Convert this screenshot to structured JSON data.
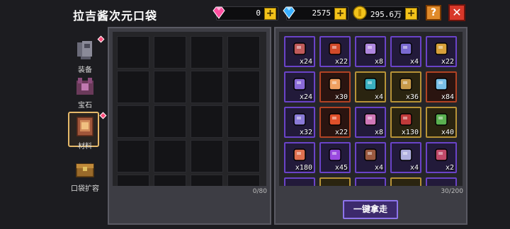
{
  "title": "拉吉酱次元口袋",
  "currencies": {
    "pink_gem": "0",
    "blue_diamond": "2575",
    "gold_coin": "295.6万"
  },
  "top_buttons": {
    "help": "?",
    "close": "✕"
  },
  "sidebar": [
    {
      "label": "装备",
      "icon": "armor-icon",
      "badge": true,
      "active": false
    },
    {
      "label": "宝石",
      "icon": "gem-chest-icon",
      "badge": false,
      "active": false
    },
    {
      "label": "材料",
      "icon": "material-book-icon",
      "badge": true,
      "active": true
    },
    {
      "label": "口袋扩容",
      "icon": "chest-expand-icon",
      "badge": false,
      "active": false
    }
  ],
  "left_panel": {
    "count": "0/80"
  },
  "right_panel": {
    "count": "30/200",
    "items": [
      {
        "icon": "horn-icon",
        "qty": "x24",
        "rarity": "purple",
        "color": "#c05a5a"
      },
      {
        "icon": "red-orb-icon",
        "qty": "x22",
        "rarity": "purple",
        "color": "#d24a2a"
      },
      {
        "icon": "purple-cube-icon",
        "qty": "x8",
        "rarity": "purple",
        "color": "#b088e0"
      },
      {
        "icon": "feather-icon",
        "qty": "x4",
        "rarity": "purple",
        "color": "#7a6ad0"
      },
      {
        "icon": "bell-icon",
        "qty": "x22",
        "rarity": "purple",
        "color": "#d8a03a"
      },
      {
        "icon": "circuit-board-icon",
        "qty": "x24",
        "rarity": "purple",
        "color": "#8a6ad8"
      },
      {
        "icon": "fire-shard-icon",
        "qty": "x30",
        "rarity": "red",
        "color": "#f0a060"
      },
      {
        "icon": "teal-crystal-icon",
        "qty": "x4",
        "rarity": "gold",
        "color": "#3ab0c0"
      },
      {
        "icon": "pickaxe-icon",
        "qty": "x36",
        "rarity": "gold",
        "color": "#c89a4a"
      },
      {
        "icon": "rune-circle-icon",
        "qty": "x84",
        "rarity": "red",
        "color": "#7ac0e8"
      },
      {
        "icon": "gadget-icon",
        "qty": "x32",
        "rarity": "purple",
        "color": "#8a7ad8"
      },
      {
        "icon": "lava-orb-icon",
        "qty": "x22",
        "rarity": "red",
        "color": "#e0502a"
      },
      {
        "icon": "wand-icon",
        "qty": "x8",
        "rarity": "purple",
        "color": "#d078b8"
      },
      {
        "icon": "dark-crystal-icon",
        "qty": "x130",
        "rarity": "gold",
        "color": "#c03a3a"
      },
      {
        "icon": "green-leaf-icon",
        "qty": "x40",
        "rarity": "gold",
        "color": "#5ab050"
      },
      {
        "icon": "salmon-gem-icon",
        "qty": "x180",
        "rarity": "purple",
        "color": "#e07050"
      },
      {
        "icon": "violet-potion-icon",
        "qty": "x45",
        "rarity": "purple",
        "color": "#9a4ae0"
      },
      {
        "icon": "brown-scroll-icon",
        "qty": "x4",
        "rarity": "purple",
        "color": "#9a5a40"
      },
      {
        "icon": "sword-icon",
        "qty": "x4",
        "rarity": "purple",
        "color": "#b0b0e0"
      },
      {
        "icon": "hook-icon",
        "qty": "x2",
        "rarity": "purple",
        "color": "#c04a6a"
      }
    ]
  },
  "take_all_button": "一键拿走",
  "colors": {
    "purple_border": "#6a43c8",
    "gold_border": "#b79337",
    "red_border": "#b14324",
    "accent_gold": "#f2c21a"
  }
}
